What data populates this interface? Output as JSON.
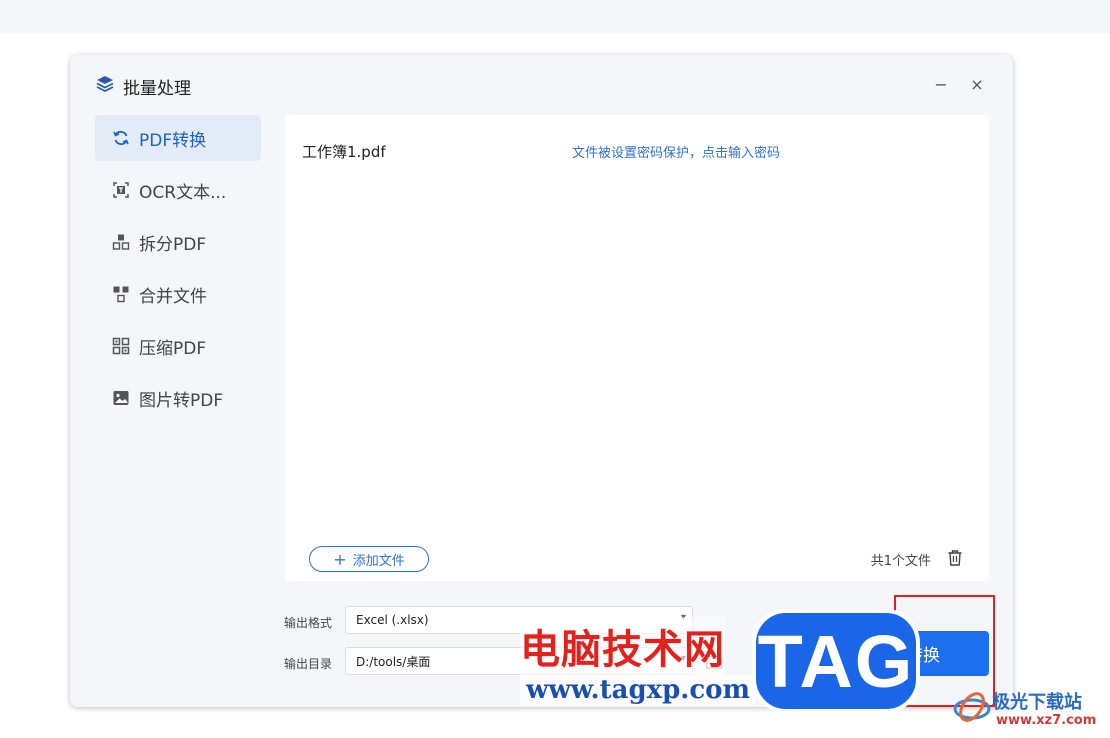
{
  "dialog": {
    "title": "批量处理",
    "minimize_glyph": "−",
    "close_glyph": "×"
  },
  "sidebar": {
    "items": [
      {
        "label": "PDF转换",
        "icon": "refresh-icon",
        "active": true
      },
      {
        "label": "OCR文本...",
        "icon": "ocr-text-icon",
        "active": false
      },
      {
        "label": "拆分PDF",
        "icon": "split-icon",
        "active": false
      },
      {
        "label": "合并文件",
        "icon": "merge-icon",
        "active": false
      },
      {
        "label": "压缩PDF",
        "icon": "compress-icon",
        "active": false
      },
      {
        "label": "图片转PDF",
        "icon": "image-icon",
        "active": false
      }
    ]
  },
  "files": [
    {
      "name": "工作簿1.pdf",
      "status": "文件被设置密码保护，点击输入密码"
    }
  ],
  "footer": {
    "add_label": "添加文件",
    "count_label": "共1个文件"
  },
  "output": {
    "format_label": "输出格式",
    "format_value": "Excel (.xlsx)",
    "dir_label": "输出目录",
    "dir_value": "D:/tools/桌面"
  },
  "convert_label": "转换",
  "watermark": {
    "cn": "电脑技术网",
    "url": "www.tagxp.com",
    "tag": "TAG",
    "site_name": "极光下载站",
    "site_url": "www.xz7.com"
  },
  "colors": {
    "accent": "#1e6ff0",
    "link": "#2f73d6",
    "highlight": "#e02020"
  }
}
